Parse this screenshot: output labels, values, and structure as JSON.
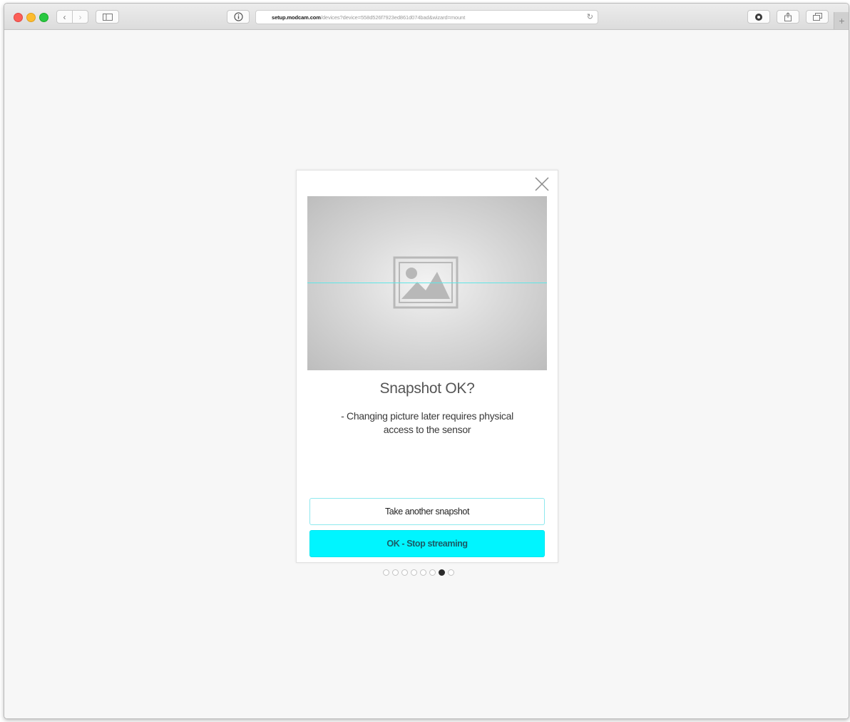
{
  "browser": {
    "url_domain": "setup.modcam.com",
    "url_rest": "/devices?device=558d526f7923ed861d074bad&wizard=mount",
    "icons": {
      "back": "chevron-left-icon",
      "forward": "chevron-right-icon",
      "sidebar": "sidebar-icon",
      "info": "info-icon",
      "reload": "reload-icon",
      "addon": "extension-icon",
      "share": "share-icon",
      "tabs": "tabs-icon",
      "new_tab": "plus-icon"
    }
  },
  "modal": {
    "title": "Snapshot OK?",
    "description": "- Changing picture later requires physical access to the sensor",
    "secondary_button": "Take another snapshot",
    "primary_button": "OK - Stop streaming",
    "accent_color": "#00f5ff"
  },
  "wizard": {
    "steps": [
      {
        "active": false
      },
      {
        "active": false
      },
      {
        "active": false
      },
      {
        "active": false
      },
      {
        "active": false
      },
      {
        "active": false
      },
      {
        "active": true
      },
      {
        "active": false
      }
    ]
  }
}
